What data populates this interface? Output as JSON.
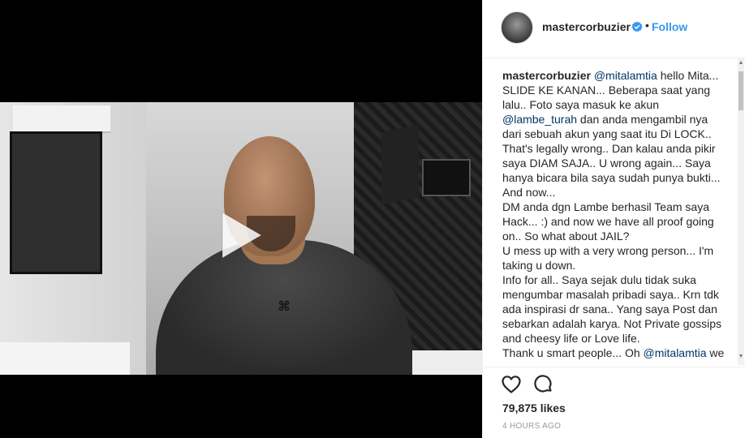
{
  "post": {
    "username": "mastercorbuzier",
    "follow_label": "Follow",
    "separator": "•",
    "video_logo_text": "⌘",
    "caption": {
      "author": "mastercorbuzier",
      "lines": [
        {
          "mention": "@mitalamtia",
          "text": " hello Mita..."
        },
        {
          "text": "SLIDE KE KANAN... Beberapa saat yang"
        },
        {
          "text": "lalu.. Foto saya masuk ke akun"
        },
        {
          "mention": "@lambe_turah",
          "text": " dan anda mengambil nya"
        },
        {
          "text": "dari sebuah akun yang saat itu Di LOCK.."
        },
        {
          "text": "That's legally wrong.. Dan kalau anda pikir"
        },
        {
          "text": "saya DIAM SAJA.. U wrong again... Saya"
        },
        {
          "text": "hanya bicara bila saya sudah punya bukti..."
        },
        {
          "text": "And now..."
        },
        {
          "text": "DM anda dgn Lambe berhasil Team saya"
        },
        {
          "text": "Hack... :) and now we have all proof going"
        },
        {
          "text": "on.. So what about JAIL?"
        },
        {
          "text": "U mess up with a very wrong person... I'm"
        },
        {
          "text": "taking u down."
        },
        {
          "text": "Info for all.. Saya sejak dulu tidak suka"
        },
        {
          "text": "mengumbar masalah pribadi saya.. Krn tdk"
        },
        {
          "text": "ada inspirasi dr sana.. Yang saya Post dan"
        },
        {
          "text": "sebarkan adalah karya. Not Private gossips"
        },
        {
          "text": "and cheesy life or Love life."
        },
        {
          "text": "Thank u smart people... Oh ",
          "mention_end": "@mitalamtia",
          "tail": " we"
        }
      ]
    },
    "likes": "79,875 likes",
    "timestamp": "4 HOURS AGO",
    "colors": {
      "link": "#3897f0",
      "mention": "#003569",
      "verified": "#3897f0",
      "text": "#262626",
      "muted": "#999999"
    },
    "icons": {
      "play": "play-icon",
      "heart": "heart-icon",
      "comment": "comment-icon",
      "verified": "verified-badge-icon"
    }
  }
}
